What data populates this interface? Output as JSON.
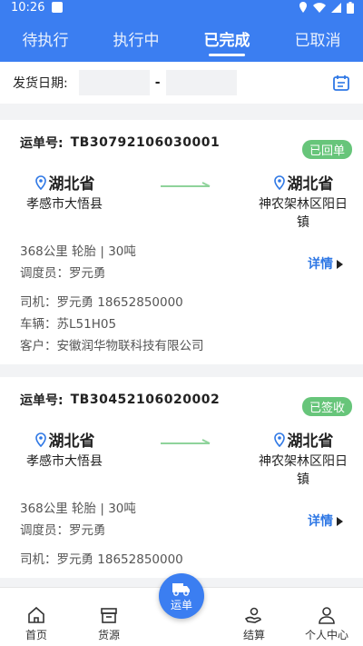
{
  "status": {
    "time": "10:26"
  },
  "tabs": [
    {
      "label": "待执行"
    },
    {
      "label": "执行中"
    },
    {
      "label": "已完成"
    },
    {
      "label": "已取消"
    }
  ],
  "filter": {
    "label": "发货日期:",
    "separator": "-"
  },
  "orders": [
    {
      "waybill_label": "运单号:",
      "waybill_no": "TB30792106030001",
      "status": "已回单",
      "from_province": "湖北省",
      "from_city": "孝感市大悟县",
      "to_province": "湖北省",
      "to_city": "神农架林区阳日镇",
      "spec": "368公里   轮胎 | 30吨",
      "dispatcher": "调度员：罗元勇",
      "driver": "司机：罗元勇     18652850000",
      "vehicle": "车辆：苏L51H05",
      "customer": "客户：安徽润华物联科技有限公司",
      "detail": "详情"
    },
    {
      "waybill_label": "运单号:",
      "waybill_no": "TB30452106020002",
      "status": "已签收",
      "from_province": "湖北省",
      "from_city": "孝感市大悟县",
      "to_province": "湖北省",
      "to_city": "神农架林区阳日镇",
      "spec": "368公里   轮胎 | 30吨",
      "dispatcher": "调度员：罗元勇",
      "driver": "司机：罗元勇     18652850000",
      "detail": "详情"
    }
  ],
  "nav": [
    {
      "label": "首页"
    },
    {
      "label": "货源"
    },
    {
      "label": "运单"
    },
    {
      "label": "结算"
    },
    {
      "label": "个人中心"
    }
  ],
  "colors": {
    "primary": "#3b7ef1",
    "badge": "#67c57a",
    "link": "#2f78e5"
  }
}
